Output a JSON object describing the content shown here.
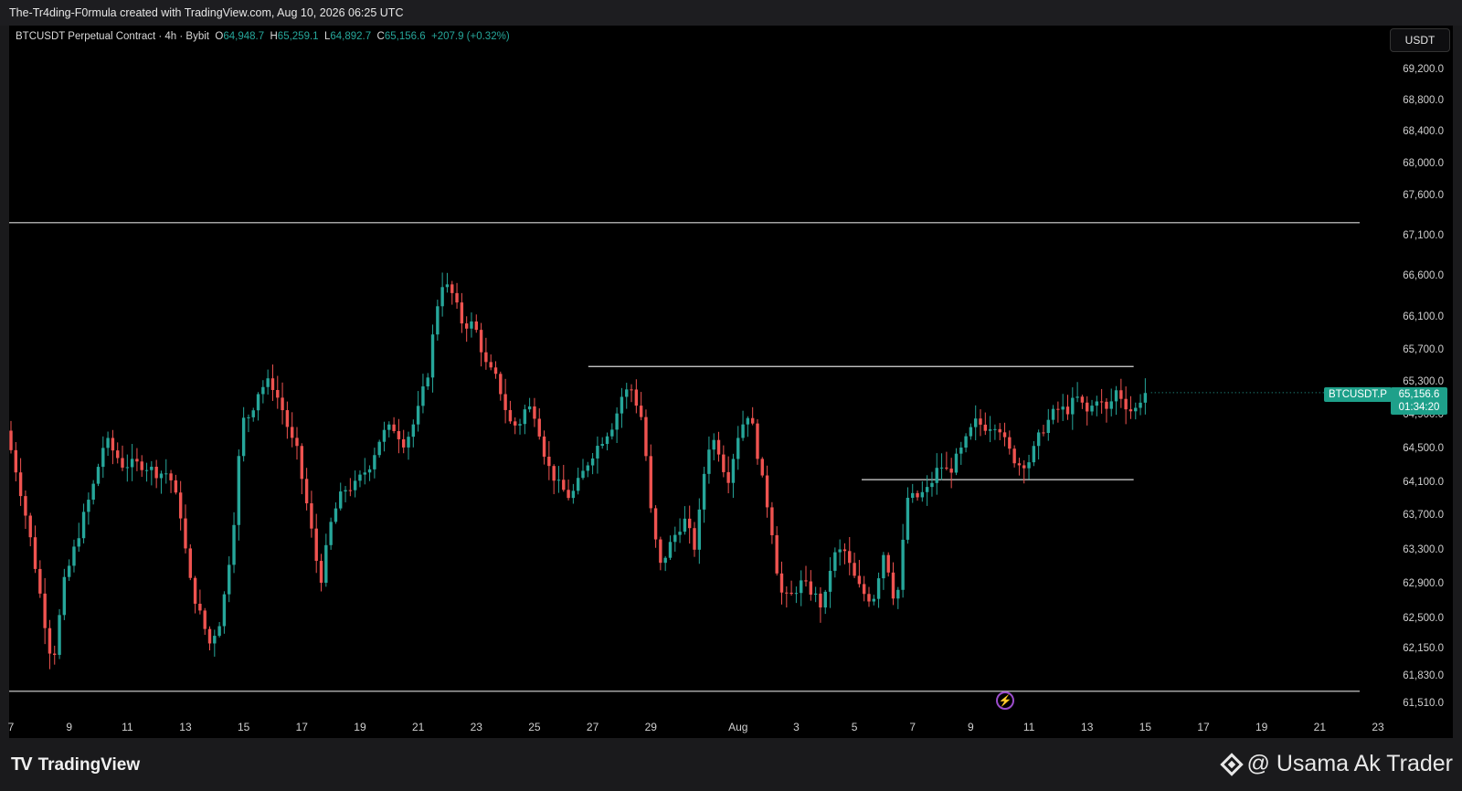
{
  "header": {
    "attribution": "The-Tr4ding-F0rmula created with TradingView.com, Aug 10, 2026 06:25 UTC"
  },
  "legend": {
    "symbol": "BTCUSDT Perpetual Contract · 4h · Bybit",
    "o_label": "O",
    "o_value": "64,948.7",
    "h_label": "H",
    "h_value": "65,259.1",
    "l_label": "L",
    "l_value": "64,892.7",
    "c_label": "C",
    "c_value": "65,156.6",
    "change": "+207.9 (+0.32%)"
  },
  "currency_button": "USDT",
  "price_tag": {
    "symbol": "BTCUSDT.P",
    "price": "65,156.6",
    "countdown": "01:34:20"
  },
  "footer": {
    "brand": "TradingView",
    "watermark": "@ Usama Ak Trader"
  },
  "colors": {
    "up": "#26a69a",
    "down": "#ef5350",
    "background": "#000000",
    "level_lines": "#d9d9d9",
    "price_tag": "#1ea08a"
  },
  "chart_data": {
    "type": "candlestick",
    "symbol": "BTCUSDT.P",
    "timeframe": "4h",
    "exchange": "Bybit",
    "y_axis": {
      "ticks": [
        "69,200.0",
        "68,800.0",
        "68,400.0",
        "68,000.0",
        "67,600.0",
        "67,100.0",
        "66,600.0",
        "66,100.0",
        "65,700.0",
        "65,300.0",
        "64,900.0",
        "64,500.0",
        "64,100.0",
        "63,700.0",
        "63,300.0",
        "62,900.0",
        "62,500.0",
        "62,150.0",
        "61,830.0",
        "61,510.0"
      ]
    },
    "x_axis": {
      "ticks": [
        "7",
        "9",
        "11",
        "13",
        "15",
        "17",
        "19",
        "21",
        "23",
        "25",
        "27",
        "29",
        "Aug",
        "3",
        "5",
        "7",
        "9",
        "11",
        "13",
        "15",
        "17",
        "19",
        "21",
        "23"
      ]
    },
    "last_price": 65156.6,
    "horizontal_levels": [
      {
        "price": 67250,
        "from_day": 7,
        "to_day": 23
      },
      {
        "price": 65480,
        "from_day": 25.85,
        "to_day": 15.0
      },
      {
        "price": 64120,
        "from_day": 6.1,
        "to_day": 15.0
      },
      {
        "price": 61640,
        "from_day": 7,
        "to_day": 23
      }
    ],
    "candles": []
  }
}
